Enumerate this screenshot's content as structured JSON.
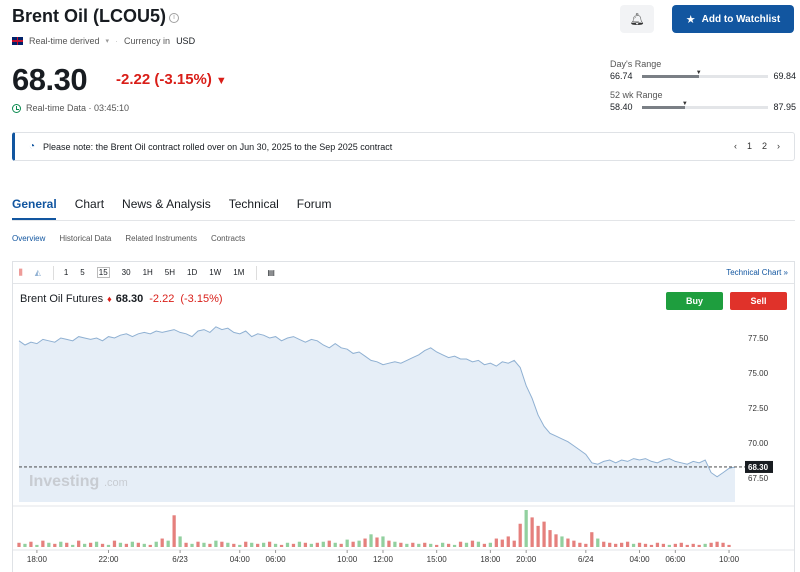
{
  "header": {
    "title": "Brent Oil (LCOU5)",
    "realtime_derived": "Real-time derived",
    "currency_label": "Currency in",
    "currency": "USD",
    "price": "68.30",
    "change": "-2.22",
    "change_pct": "(-3.15%)",
    "realtime_data": "Real-time Data · 03:45:10",
    "watchlist_label": "Add to Watchlist"
  },
  "ranges": {
    "day": {
      "label": "Day's Range",
      "low": "66.74",
      "high": "69.84",
      "position": 0.45
    },
    "week52": {
      "label": "52 wk Range",
      "low": "58.40",
      "high": "87.95",
      "position": 0.34
    }
  },
  "notice": {
    "text": "Please note: the Brent Oil contract rolled over on Jun 30, 2025 to the Sep 2025 contract",
    "pages": [
      "1",
      "2"
    ]
  },
  "tabs": [
    {
      "label": "General",
      "active": true
    },
    {
      "label": "Chart"
    },
    {
      "label": "News & Analysis"
    },
    {
      "label": "Technical"
    },
    {
      "label": "Forum"
    }
  ],
  "subtabs": [
    {
      "label": "Overview",
      "active": true
    },
    {
      "label": "Historical Data"
    },
    {
      "label": "Related Instruments"
    },
    {
      "label": "Contracts"
    }
  ],
  "toolbar": {
    "intervals": [
      "1",
      "5",
      "15",
      "30",
      "1H",
      "5H",
      "1D",
      "1W",
      "1M"
    ],
    "selected": "15",
    "technical_chart": "Technical Chart »"
  },
  "chart_header": {
    "name": "Brent Oil Futures",
    "price": "68.30",
    "change": "-2.22",
    "change_pct": "(-3.15%)",
    "buy": "Buy",
    "sell": "Sell",
    "watermark": "Investing",
    "watermark_suffix": ".com"
  },
  "colors": {
    "accent": "#1256a0",
    "down": "#d91e18",
    "up": "#1e9e3e",
    "area_line": "#8fb0d2",
    "area_fill": "#e6eef7"
  },
  "chart_data": {
    "type": "area",
    "last_value": "68.30",
    "y_ticks": [
      "77.50",
      "75.00",
      "72.50",
      "70.00",
      "67.50"
    ],
    "ylim": [
      65.8,
      79.0
    ],
    "x_ticks": [
      "18:00",
      "22:00",
      "6/23",
      "04:00",
      "06:00",
      "10:00",
      "12:00",
      "15:00",
      "18:00",
      "20:00",
      "6/24",
      "04:00",
      "06:00",
      "10:00"
    ],
    "x_tick_index": [
      3,
      15,
      27,
      37,
      43,
      55,
      61,
      70,
      79,
      85,
      95,
      104,
      110,
      119
    ],
    "values": [
      77.3,
      77.0,
      77.2,
      77.1,
      77.4,
      77.3,
      77.2,
      77.5,
      77.4,
      77.3,
      77.6,
      77.5,
      77.4,
      77.5,
      77.3,
      77.6,
      77.5,
      77.7,
      77.8,
      77.6,
      77.8,
      77.9,
      77.8,
      78.0,
      77.9,
      78.0,
      78.1,
      77.9,
      77.8,
      77.6,
      78.0,
      78.1,
      77.9,
      78.3,
      78.1,
      78.2,
      77.9,
      77.8,
      78.0,
      77.6,
      77.8,
      77.7,
      77.5,
      77.6,
      77.3,
      77.5,
      77.6,
      77.4,
      77.2,
      77.4,
      77.3,
      77.0,
      76.8,
      77.1,
      76.8,
      76.7,
      76.4,
      76.5,
      76.2,
      75.9,
      75.8,
      75.6,
      75.7,
      75.8,
      75.7,
      75.9,
      76.1,
      76.3,
      76.6,
      76.8,
      76.5,
      76.3,
      76.1,
      76.2,
      76.0,
      76.0,
      75.8,
      75.9,
      75.6,
      75.7,
      75.5,
      75.8,
      75.7,
      75.9,
      75.4,
      74.1,
      73.2,
      72.0,
      71.2,
      70.7,
      70.5,
      70.3,
      70.1,
      69.8,
      69.5,
      69.2,
      68.6,
      68.5,
      68.7,
      68.8,
      68.6,
      68.8,
      68.7,
      68.9,
      68.8,
      68.9,
      68.7,
      68.6,
      68.8,
      68.9,
      68.7,
      68.6,
      68.5,
      68.7,
      68.6,
      68.8,
      67.9,
      67.6,
      67.9,
      68.2,
      68.3
    ],
    "volume": [
      4,
      3,
      5,
      2,
      6,
      4,
      3,
      5,
      4,
      2,
      6,
      3,
      4,
      5,
      3,
      2,
      6,
      4,
      3,
      5,
      4,
      3,
      2,
      5,
      8,
      6,
      30,
      10,
      4,
      3,
      5,
      4,
      3,
      6,
      5,
      4,
      3,
      2,
      5,
      4,
      3,
      4,
      5,
      3,
      2,
      4,
      3,
      5,
      4,
      3,
      4,
      5,
      6,
      4,
      3,
      7,
      5,
      6,
      8,
      12,
      9,
      10,
      6,
      5,
      4,
      3,
      4,
      3,
      4,
      3,
      2,
      4,
      3,
      2,
      5,
      4,
      6,
      5,
      3,
      4,
      8,
      7,
      10,
      6,
      22,
      35,
      28,
      20,
      24,
      16,
      12,
      10,
      8,
      6,
      4,
      3,
      14,
      8,
      5,
      4,
      3,
      4,
      5,
      3,
      4,
      3,
      2,
      4,
      3,
      2,
      3,
      4,
      2,
      3,
      2,
      3,
      4,
      5,
      4,
      2
    ],
    "volume_colors_down_from": 78
  }
}
